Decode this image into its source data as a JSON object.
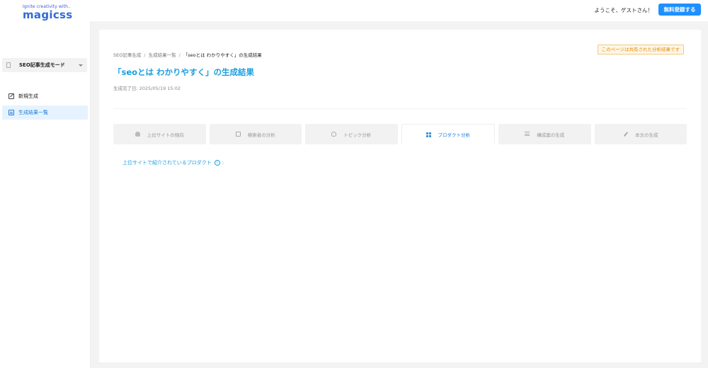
{
  "header": {
    "logo_tagline": "Ignite creativity with..",
    "logo_text": "magicss",
    "welcome": "ようこそ、ゲストさん！",
    "signup_label": "無料登録する"
  },
  "sidebar": {
    "mode_select": "SEO記事生成モード",
    "items": [
      {
        "label": "新規生成",
        "icon": "edit-icon"
      },
      {
        "label": "生成結果一覧",
        "icon": "list-icon"
      }
    ]
  },
  "breadcrumb": [
    "SEO記事生成",
    "生成結果一覧",
    "「seoとは わかりやすく」の生成結果"
  ],
  "breadcrumb_sep": "/",
  "shared_badge": "このページは共有された分析結果です",
  "page_title": "「seoとは わかりやすく」の生成結果",
  "completed_at": "生成完了日: 2025/05/19 15:02",
  "tabs": [
    {
      "label": "上位サイトの傾向",
      "icon": "crown-icon"
    },
    {
      "label": "検索者の分析",
      "icon": "card-icon"
    },
    {
      "label": "トピック分析",
      "icon": "bulb-icon"
    },
    {
      "label": "プロダクト分析",
      "icon": "grid-icon",
      "active": true
    },
    {
      "label": "構成案の生成",
      "icon": "lines-icon"
    },
    {
      "label": "本文の生成",
      "icon": "pen-icon"
    }
  ],
  "section_label": "上位サイトで紹介されているプロダクト",
  "section_info": "i",
  "section_colon": ":",
  "colors": {
    "accent": "#1a9fe0",
    "button": "#1e90ff",
    "badge_text": "#e08a00"
  }
}
